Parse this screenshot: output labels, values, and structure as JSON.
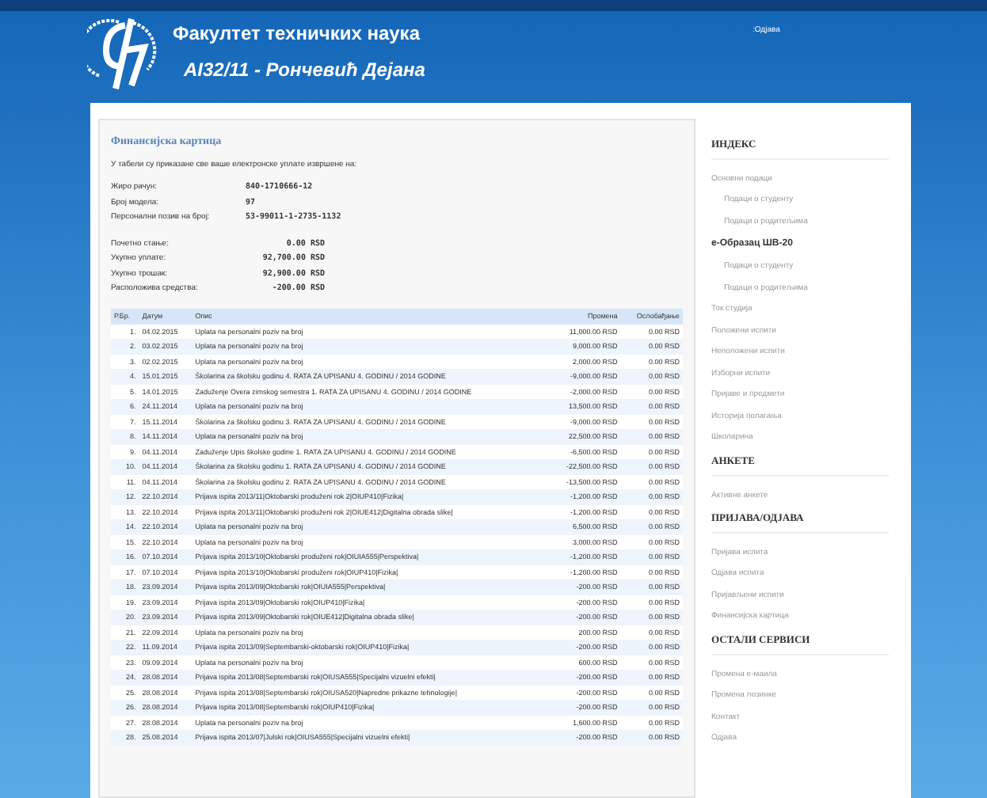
{
  "header": {
    "title": "Факултет техничких наука",
    "subtitle": "AI32/11 - Рончевић Дејана",
    "logout": ":Одјава"
  },
  "page": {
    "title": "Финансијска картица",
    "intro": "У табели су приказане све ваше електронске уплате извршене на:",
    "account_fields": [
      {
        "label": "Жиро рачун:",
        "value": "840-1710666-12"
      },
      {
        "label": "Број модела:",
        "value": "97"
      },
      {
        "label": "Персонални позив на број:",
        "value": "53-99011-1-2735-1132"
      }
    ],
    "balance_fields": [
      {
        "label": "Почетно стање:",
        "value": "0.00 RSD"
      },
      {
        "label": "Укупно уплате:",
        "value": "92,700.00 RSD"
      },
      {
        "label": "Укупно трошак:",
        "value": "92,900.00 RSD"
      },
      {
        "label": "Расположива средства:",
        "value": "-200.00 RSD"
      }
    ]
  },
  "table": {
    "columns": [
      "Р.Бр.",
      "Датум",
      "Опис",
      "Промена",
      "Ослобађање"
    ],
    "rows": [
      [
        "1.",
        "04.02.2015",
        "Uplata na personalni poziv na broj",
        "11,000.00 RSD",
        "0.00 RSD"
      ],
      [
        "2.",
        "03.02.2015",
        "Uplata na personalni poziv na broj",
        "9,000.00 RSD",
        "0.00 RSD"
      ],
      [
        "3.",
        "02.02.2015",
        "Uplata na personalni poziv na broj",
        "2,000.00 RSD",
        "0.00 RSD"
      ],
      [
        "4.",
        "15.01.2015",
        "Školarina za školsku godinu 4. RATA ZA UPISANU 4. GODINU / 2014 GODINE",
        "-9,000.00 RSD",
        "0.00 RSD"
      ],
      [
        "5.",
        "14.01.2015",
        "Zaduženje Overa zimskog semestra 1. RATA ZA UPISANU 4. GODINU / 2014 GODINE",
        "-2,000.00 RSD",
        "0.00 RSD"
      ],
      [
        "6.",
        "24.11.2014",
        "Uplata na personalni poziv na broj",
        "13,500.00 RSD",
        "0.00 RSD"
      ],
      [
        "7.",
        "15.11.2014",
        "Školarina za školsku godinu 3. RATA ZA UPISANU 4. GODINU / 2014 GODINE",
        "-9,000.00 RSD",
        "0.00 RSD"
      ],
      [
        "8.",
        "14.11.2014",
        "Uplata na personalni poziv na broj",
        "22,500.00 RSD",
        "0.00 RSD"
      ],
      [
        "9.",
        "04.11.2014",
        "Zaduženje Upis školske godine 1. RATA ZA UPISANU 4. GODINU / 2014 GODINE",
        "-6,500.00 RSD",
        "0.00 RSD"
      ],
      [
        "10.",
        "04.11.2014",
        "Školarina za školsku godinu 1. RATA ZA UPISANU 4. GODINU / 2014 GODINE",
        "-22,500.00 RSD",
        "0.00 RSD"
      ],
      [
        "11.",
        "04.11.2014",
        "Školarina za školsku godinu 2. RATA ZA UPISANU 4. GODINU / 2014 GODINE",
        "-13,500.00 RSD",
        "0.00 RSD"
      ],
      [
        "12.",
        "22.10.2014",
        "Prijava ispita 2013/11|Oktobarski produženi rok 2|OIUP410|Fizika|",
        "-1,200.00 RSD",
        "0.00 RSD"
      ],
      [
        "13.",
        "22.10.2014",
        "Prijava ispita 2013/11|Oktobarski produženi rok 2|OIUE412|Digitalna obrada slike|",
        "-1,200.00 RSD",
        "0.00 RSD"
      ],
      [
        "14.",
        "22.10.2014",
        "Uplata na personalni poziv na broj",
        "6,500.00 RSD",
        "0.00 RSD"
      ],
      [
        "15.",
        "22.10.2014",
        "Uplata na personalni poziv na broj",
        "3,000.00 RSD",
        "0.00 RSD"
      ],
      [
        "16.",
        "07.10.2014",
        "Prijava ispita 2013/10|Oktobarski produženi rok|OIUIA555|Perspektiva|",
        "-1,200.00 RSD",
        "0.00 RSD"
      ],
      [
        "17.",
        "07.10.2014",
        "Prijava ispita 2013/10|Oktobarski produženi rok|OIUP410|Fizika|",
        "-1,200.00 RSD",
        "0.00 RSD"
      ],
      [
        "18.",
        "23.09.2014",
        "Prijava ispita 2013/09|Oktobarski rok|OIUIA555|Perspektiva|",
        "-200.00 RSD",
        "0.00 RSD"
      ],
      [
        "19.",
        "23.09.2014",
        "Prijava ispita 2013/09|Oktobarski rok|OIUP410|Fizika|",
        "-200.00 RSD",
        "0.00 RSD"
      ],
      [
        "20.",
        "23.09.2014",
        "Prijava ispita 2013/09|Oktobarski rok|OIUE412|Digitalna obrada slike|",
        "-200.00 RSD",
        "0.00 RSD"
      ],
      [
        "21.",
        "22.09.2014",
        "Uplata na personalni poziv na broj",
        "200.00 RSD",
        "0.00 RSD"
      ],
      [
        "22.",
        "11.09.2014",
        "Prijava ispita 2013/09|Septembarski-oktobarski rok|OIUP410|Fizika|",
        "-200.00 RSD",
        "0.00 RSD"
      ],
      [
        "23.",
        "09.09.2014",
        "Uplata na personalni poziv na broj",
        "600.00 RSD",
        "0.00 RSD"
      ],
      [
        "24.",
        "28.08.2014",
        "Prijava ispita 2013/08|Septembarski rok|OIUSA555|Specijalni vizuelni efekti|",
        "-200.00 RSD",
        "0.00 RSD"
      ],
      [
        "25.",
        "28.08.2014",
        "Prijava ispita 2013/08|Septembarski rok|OIUSA520|Napredne prikazne tehnologije|",
        "-200.00 RSD",
        "0.00 RSD"
      ],
      [
        "26.",
        "28.08.2014",
        "Prijava ispita 2013/08|Septembarski rok|OIUP410|Fizika|",
        "-200.00 RSD",
        "0.00 RSD"
      ],
      [
        "27.",
        "28.08.2014",
        "Uplata na personalni poziv na broj",
        "1,600.00 RSD",
        "0.00 RSD"
      ],
      [
        "28.",
        "25.08.2014",
        "Prijava ispita 2013/07|Julski rok|OIUSA555|Specijalni vizuelni efekti|",
        "-200.00 RSD",
        "0.00 RSD"
      ]
    ]
  },
  "sidebar": [
    {
      "heading": "ИНДЕКС",
      "items": [
        {
          "kind": "link",
          "label": "Основни подаци",
          "children": [
            {
              "kind": "link",
              "label": "Подаци о студенту"
            },
            {
              "kind": "link",
              "label": "Подаци о родитељима"
            }
          ]
        },
        {
          "kind": "group",
          "label": "е-Образац ШВ-20",
          "children": [
            {
              "kind": "link",
              "label": "Подаци о студенту"
            },
            {
              "kind": "link",
              "label": "Подаци о родитељима"
            }
          ]
        },
        {
          "kind": "link",
          "label": "Ток студија"
        },
        {
          "kind": "link",
          "label": "Положени испити"
        },
        {
          "kind": "link",
          "label": "Неположени испити"
        },
        {
          "kind": "link",
          "label": "Изборни испити"
        },
        {
          "kind": "link",
          "label": "Пријаве и предмети"
        },
        {
          "kind": "link",
          "label": "Историја полагања"
        },
        {
          "kind": "link",
          "label": "Школарина"
        }
      ]
    },
    {
      "heading": "АНКЕТЕ",
      "items": [
        {
          "kind": "link",
          "label": "Активне анкете"
        }
      ]
    },
    {
      "heading": "ПРИЈАВА/ОДЈАВА",
      "items": [
        {
          "kind": "link",
          "label": "Пријава испита"
        },
        {
          "kind": "link",
          "label": "Одјава испита"
        },
        {
          "kind": "link",
          "label": "Пријављени испити"
        },
        {
          "kind": "link",
          "label": "Финансијска картица"
        }
      ]
    },
    {
      "heading": "ОСТАЛИ СЕРВИСИ",
      "items": [
        {
          "kind": "link",
          "label": "Промена е-маила"
        },
        {
          "kind": "link",
          "label": "Промена лозинке"
        },
        {
          "kind": "link",
          "label": "Контакт"
        },
        {
          "kind": "link",
          "label": "Одјава"
        }
      ]
    }
  ]
}
